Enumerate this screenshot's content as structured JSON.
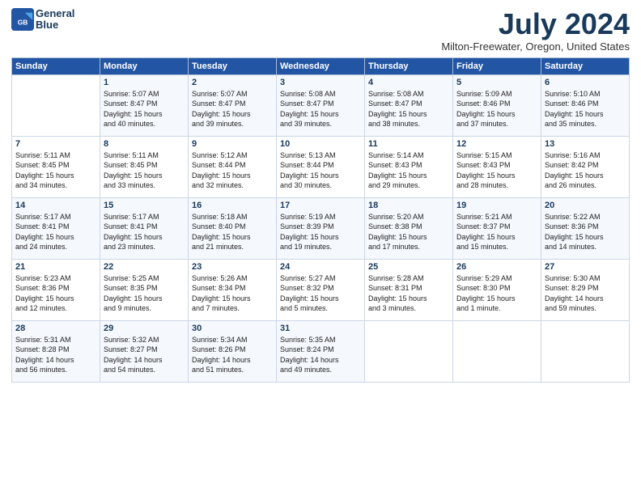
{
  "header": {
    "logo_line1": "General",
    "logo_line2": "Blue",
    "title": "July 2024",
    "location": "Milton-Freewater, Oregon, United States"
  },
  "weekdays": [
    "Sunday",
    "Monday",
    "Tuesday",
    "Wednesday",
    "Thursday",
    "Friday",
    "Saturday"
  ],
  "weeks": [
    [
      {
        "num": "",
        "lines": []
      },
      {
        "num": "1",
        "lines": [
          "Sunrise: 5:07 AM",
          "Sunset: 8:47 PM",
          "Daylight: 15 hours",
          "and 40 minutes."
        ]
      },
      {
        "num": "2",
        "lines": [
          "Sunrise: 5:07 AM",
          "Sunset: 8:47 PM",
          "Daylight: 15 hours",
          "and 39 minutes."
        ]
      },
      {
        "num": "3",
        "lines": [
          "Sunrise: 5:08 AM",
          "Sunset: 8:47 PM",
          "Daylight: 15 hours",
          "and 39 minutes."
        ]
      },
      {
        "num": "4",
        "lines": [
          "Sunrise: 5:08 AM",
          "Sunset: 8:47 PM",
          "Daylight: 15 hours",
          "and 38 minutes."
        ]
      },
      {
        "num": "5",
        "lines": [
          "Sunrise: 5:09 AM",
          "Sunset: 8:46 PM",
          "Daylight: 15 hours",
          "and 37 minutes."
        ]
      },
      {
        "num": "6",
        "lines": [
          "Sunrise: 5:10 AM",
          "Sunset: 8:46 PM",
          "Daylight: 15 hours",
          "and 35 minutes."
        ]
      }
    ],
    [
      {
        "num": "7",
        "lines": [
          "Sunrise: 5:11 AM",
          "Sunset: 8:45 PM",
          "Daylight: 15 hours",
          "and 34 minutes."
        ]
      },
      {
        "num": "8",
        "lines": [
          "Sunrise: 5:11 AM",
          "Sunset: 8:45 PM",
          "Daylight: 15 hours",
          "and 33 minutes."
        ]
      },
      {
        "num": "9",
        "lines": [
          "Sunrise: 5:12 AM",
          "Sunset: 8:44 PM",
          "Daylight: 15 hours",
          "and 32 minutes."
        ]
      },
      {
        "num": "10",
        "lines": [
          "Sunrise: 5:13 AM",
          "Sunset: 8:44 PM",
          "Daylight: 15 hours",
          "and 30 minutes."
        ]
      },
      {
        "num": "11",
        "lines": [
          "Sunrise: 5:14 AM",
          "Sunset: 8:43 PM",
          "Daylight: 15 hours",
          "and 29 minutes."
        ]
      },
      {
        "num": "12",
        "lines": [
          "Sunrise: 5:15 AM",
          "Sunset: 8:43 PM",
          "Daylight: 15 hours",
          "and 28 minutes."
        ]
      },
      {
        "num": "13",
        "lines": [
          "Sunrise: 5:16 AM",
          "Sunset: 8:42 PM",
          "Daylight: 15 hours",
          "and 26 minutes."
        ]
      }
    ],
    [
      {
        "num": "14",
        "lines": [
          "Sunrise: 5:17 AM",
          "Sunset: 8:41 PM",
          "Daylight: 15 hours",
          "and 24 minutes."
        ]
      },
      {
        "num": "15",
        "lines": [
          "Sunrise: 5:17 AM",
          "Sunset: 8:41 PM",
          "Daylight: 15 hours",
          "and 23 minutes."
        ]
      },
      {
        "num": "16",
        "lines": [
          "Sunrise: 5:18 AM",
          "Sunset: 8:40 PM",
          "Daylight: 15 hours",
          "and 21 minutes."
        ]
      },
      {
        "num": "17",
        "lines": [
          "Sunrise: 5:19 AM",
          "Sunset: 8:39 PM",
          "Daylight: 15 hours",
          "and 19 minutes."
        ]
      },
      {
        "num": "18",
        "lines": [
          "Sunrise: 5:20 AM",
          "Sunset: 8:38 PM",
          "Daylight: 15 hours",
          "and 17 minutes."
        ]
      },
      {
        "num": "19",
        "lines": [
          "Sunrise: 5:21 AM",
          "Sunset: 8:37 PM",
          "Daylight: 15 hours",
          "and 15 minutes."
        ]
      },
      {
        "num": "20",
        "lines": [
          "Sunrise: 5:22 AM",
          "Sunset: 8:36 PM",
          "Daylight: 15 hours",
          "and 14 minutes."
        ]
      }
    ],
    [
      {
        "num": "21",
        "lines": [
          "Sunrise: 5:23 AM",
          "Sunset: 8:36 PM",
          "Daylight: 15 hours",
          "and 12 minutes."
        ]
      },
      {
        "num": "22",
        "lines": [
          "Sunrise: 5:25 AM",
          "Sunset: 8:35 PM",
          "Daylight: 15 hours",
          "and 9 minutes."
        ]
      },
      {
        "num": "23",
        "lines": [
          "Sunrise: 5:26 AM",
          "Sunset: 8:34 PM",
          "Daylight: 15 hours",
          "and 7 minutes."
        ]
      },
      {
        "num": "24",
        "lines": [
          "Sunrise: 5:27 AM",
          "Sunset: 8:32 PM",
          "Daylight: 15 hours",
          "and 5 minutes."
        ]
      },
      {
        "num": "25",
        "lines": [
          "Sunrise: 5:28 AM",
          "Sunset: 8:31 PM",
          "Daylight: 15 hours",
          "and 3 minutes."
        ]
      },
      {
        "num": "26",
        "lines": [
          "Sunrise: 5:29 AM",
          "Sunset: 8:30 PM",
          "Daylight: 15 hours",
          "and 1 minute."
        ]
      },
      {
        "num": "27",
        "lines": [
          "Sunrise: 5:30 AM",
          "Sunset: 8:29 PM",
          "Daylight: 14 hours",
          "and 59 minutes."
        ]
      }
    ],
    [
      {
        "num": "28",
        "lines": [
          "Sunrise: 5:31 AM",
          "Sunset: 8:28 PM",
          "Daylight: 14 hours",
          "and 56 minutes."
        ]
      },
      {
        "num": "29",
        "lines": [
          "Sunrise: 5:32 AM",
          "Sunset: 8:27 PM",
          "Daylight: 14 hours",
          "and 54 minutes."
        ]
      },
      {
        "num": "30",
        "lines": [
          "Sunrise: 5:34 AM",
          "Sunset: 8:26 PM",
          "Daylight: 14 hours",
          "and 51 minutes."
        ]
      },
      {
        "num": "31",
        "lines": [
          "Sunrise: 5:35 AM",
          "Sunset: 8:24 PM",
          "Daylight: 14 hours",
          "and 49 minutes."
        ]
      },
      {
        "num": "",
        "lines": []
      },
      {
        "num": "",
        "lines": []
      },
      {
        "num": "",
        "lines": []
      }
    ]
  ]
}
